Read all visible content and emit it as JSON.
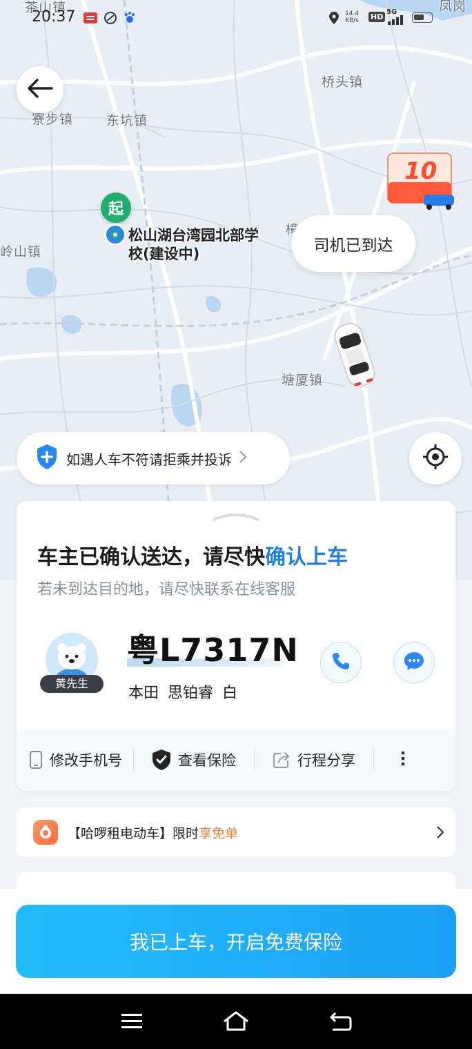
{
  "status_bar": {
    "time": "20:37",
    "net_speed_value": "14.4",
    "net_speed_unit": "KB/s",
    "hd": "HD",
    "signal": "5G"
  },
  "map": {
    "towns": [
      "茶山镇",
      "寮步镇",
      "东坑镇",
      "桥头镇",
      "岭山镇",
      "塘厦镇",
      "樟",
      "凤岗"
    ],
    "start_badge": "起",
    "start_line1": "松山湖台湾园北部学",
    "start_line2": "校(建设中)",
    "driver_status": "司机已到达",
    "promo_amount": "10",
    "safety_tip": "如遇人车不符请拒乘并投诉"
  },
  "card": {
    "headline_prefix": "车主已确认送达，请尽快",
    "headline_highlight": "确认上车",
    "subline": "若未到达目的地，请尽快联系在线客服",
    "driver_name": "黄先生",
    "plate": "粤L7317N",
    "car_desc": "本田 思铂睿 白",
    "actions": [
      "修改手机号",
      "查看保险",
      "行程分享"
    ]
  },
  "promo": {
    "prefix": "【哈啰租电动车】限时",
    "highlight": "享免单"
  },
  "confirm_button": "我已上车，开启免费保险",
  "colors": {
    "accent_blue": "#1f7fe6",
    "button_blue": "#1aa0f5",
    "start_green": "#1fae6e",
    "promo_orange": "#ff7a2e"
  },
  "icons": [
    "back-arrow-icon",
    "shield-plus-icon",
    "locate-icon",
    "phone-icon",
    "chat-icon",
    "mobile-phone-icon",
    "insurance-shield-icon",
    "share-icon",
    "more-icon",
    "menu-icon",
    "home-icon",
    "back-icon"
  ]
}
